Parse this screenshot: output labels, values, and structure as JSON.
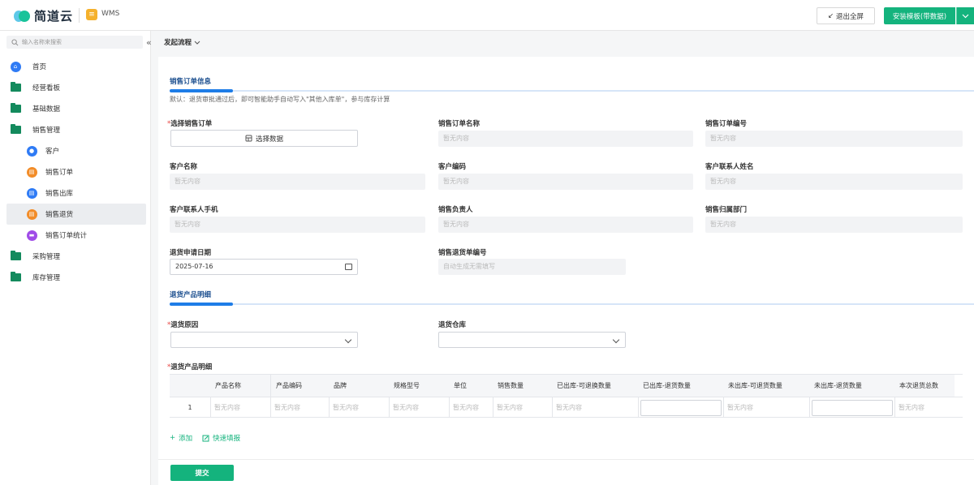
{
  "brand": {
    "name": "简道云",
    "app_name": "WMS",
    "app_icon_glyph": "≡"
  },
  "header": {
    "exit_fullscreen": "退出全屏",
    "exit_icon": "↙",
    "install_template": "安装模板(带数据)"
  },
  "sidebar": {
    "search_placeholder": "输入名称来搜索",
    "collapse_glyph": "«",
    "items": [
      {
        "label": "首页",
        "icon": "home-icon"
      },
      {
        "label": "经营看板",
        "icon": "folder-icon"
      },
      {
        "label": "基础数据",
        "icon": "folder-icon"
      },
      {
        "label": "销售管理",
        "icon": "folder-icon"
      },
      {
        "label": "客户",
        "icon": "user-icon",
        "color": "#2f7bf5"
      },
      {
        "label": "销售订单",
        "icon": "form-icon",
        "color": "#f28c28"
      },
      {
        "label": "销售出库",
        "icon": "form-icon",
        "color": "#2f7bf5"
      },
      {
        "label": "销售退货",
        "icon": "form-icon",
        "color": "#f28c28"
      },
      {
        "label": "销售订单统计",
        "icon": "chart-icon",
        "color": "#a04ce8"
      },
      {
        "label": "采购管理",
        "icon": "folder-icon"
      },
      {
        "label": "库存管理",
        "icon": "folder-icon"
      }
    ]
  },
  "tabbar": {
    "flow_label": "发起流程"
  },
  "form": {
    "section1_title": "销售订单信息",
    "hint": "默认：退货审批通过后，即可智能助手自动写入\"其他入库单\"，参与库存计算",
    "select_order_label": "选择销售订单",
    "select_data_button": "选择数据",
    "order_name_label": "销售订单名称",
    "order_no_label": "销售订单编号",
    "customer_name_label": "客户名称",
    "customer_code_label": "客户编码",
    "contact_name_label": "客户联系人姓名",
    "contact_phone_label": "客户联系人手机",
    "sales_owner_label": "销售负责人",
    "sales_dept_label": "销售归属部门",
    "return_date_label": "退货申请日期",
    "return_date_value": "2025-07-16",
    "return_no_label": "销售退货单编号",
    "return_no_placeholder": "自动生成无需填写",
    "empty": "暂无内容",
    "section2_title": "退货产品明细",
    "reason_label": "退货原因",
    "warehouse_label": "退货仓库",
    "detail_label": "退货产品明细",
    "add_label": "添加",
    "quick_fill_label": "快速填报",
    "submit_label": "提交"
  },
  "table": {
    "columns": [
      "产品名称",
      "产品编码",
      "品牌",
      "规格型号",
      "单位",
      "销售数量",
      "已出库-可退换数量",
      "已出库-退货数量",
      "未出库-可退货数量",
      "未出库-退货数量",
      "本次退货总数"
    ],
    "row_index": "1",
    "row_values": [
      "暂无内容",
      "暂无内容",
      "暂无内容",
      "暂无内容",
      "暂无内容",
      "暂无内容",
      "暂无内容",
      "",
      "暂无内容",
      "",
      "暂无内容"
    ]
  },
  "colors": {
    "brand_green": "#14b37d",
    "accent_blue": "#1e7de7",
    "required_red": "#e64340"
  }
}
